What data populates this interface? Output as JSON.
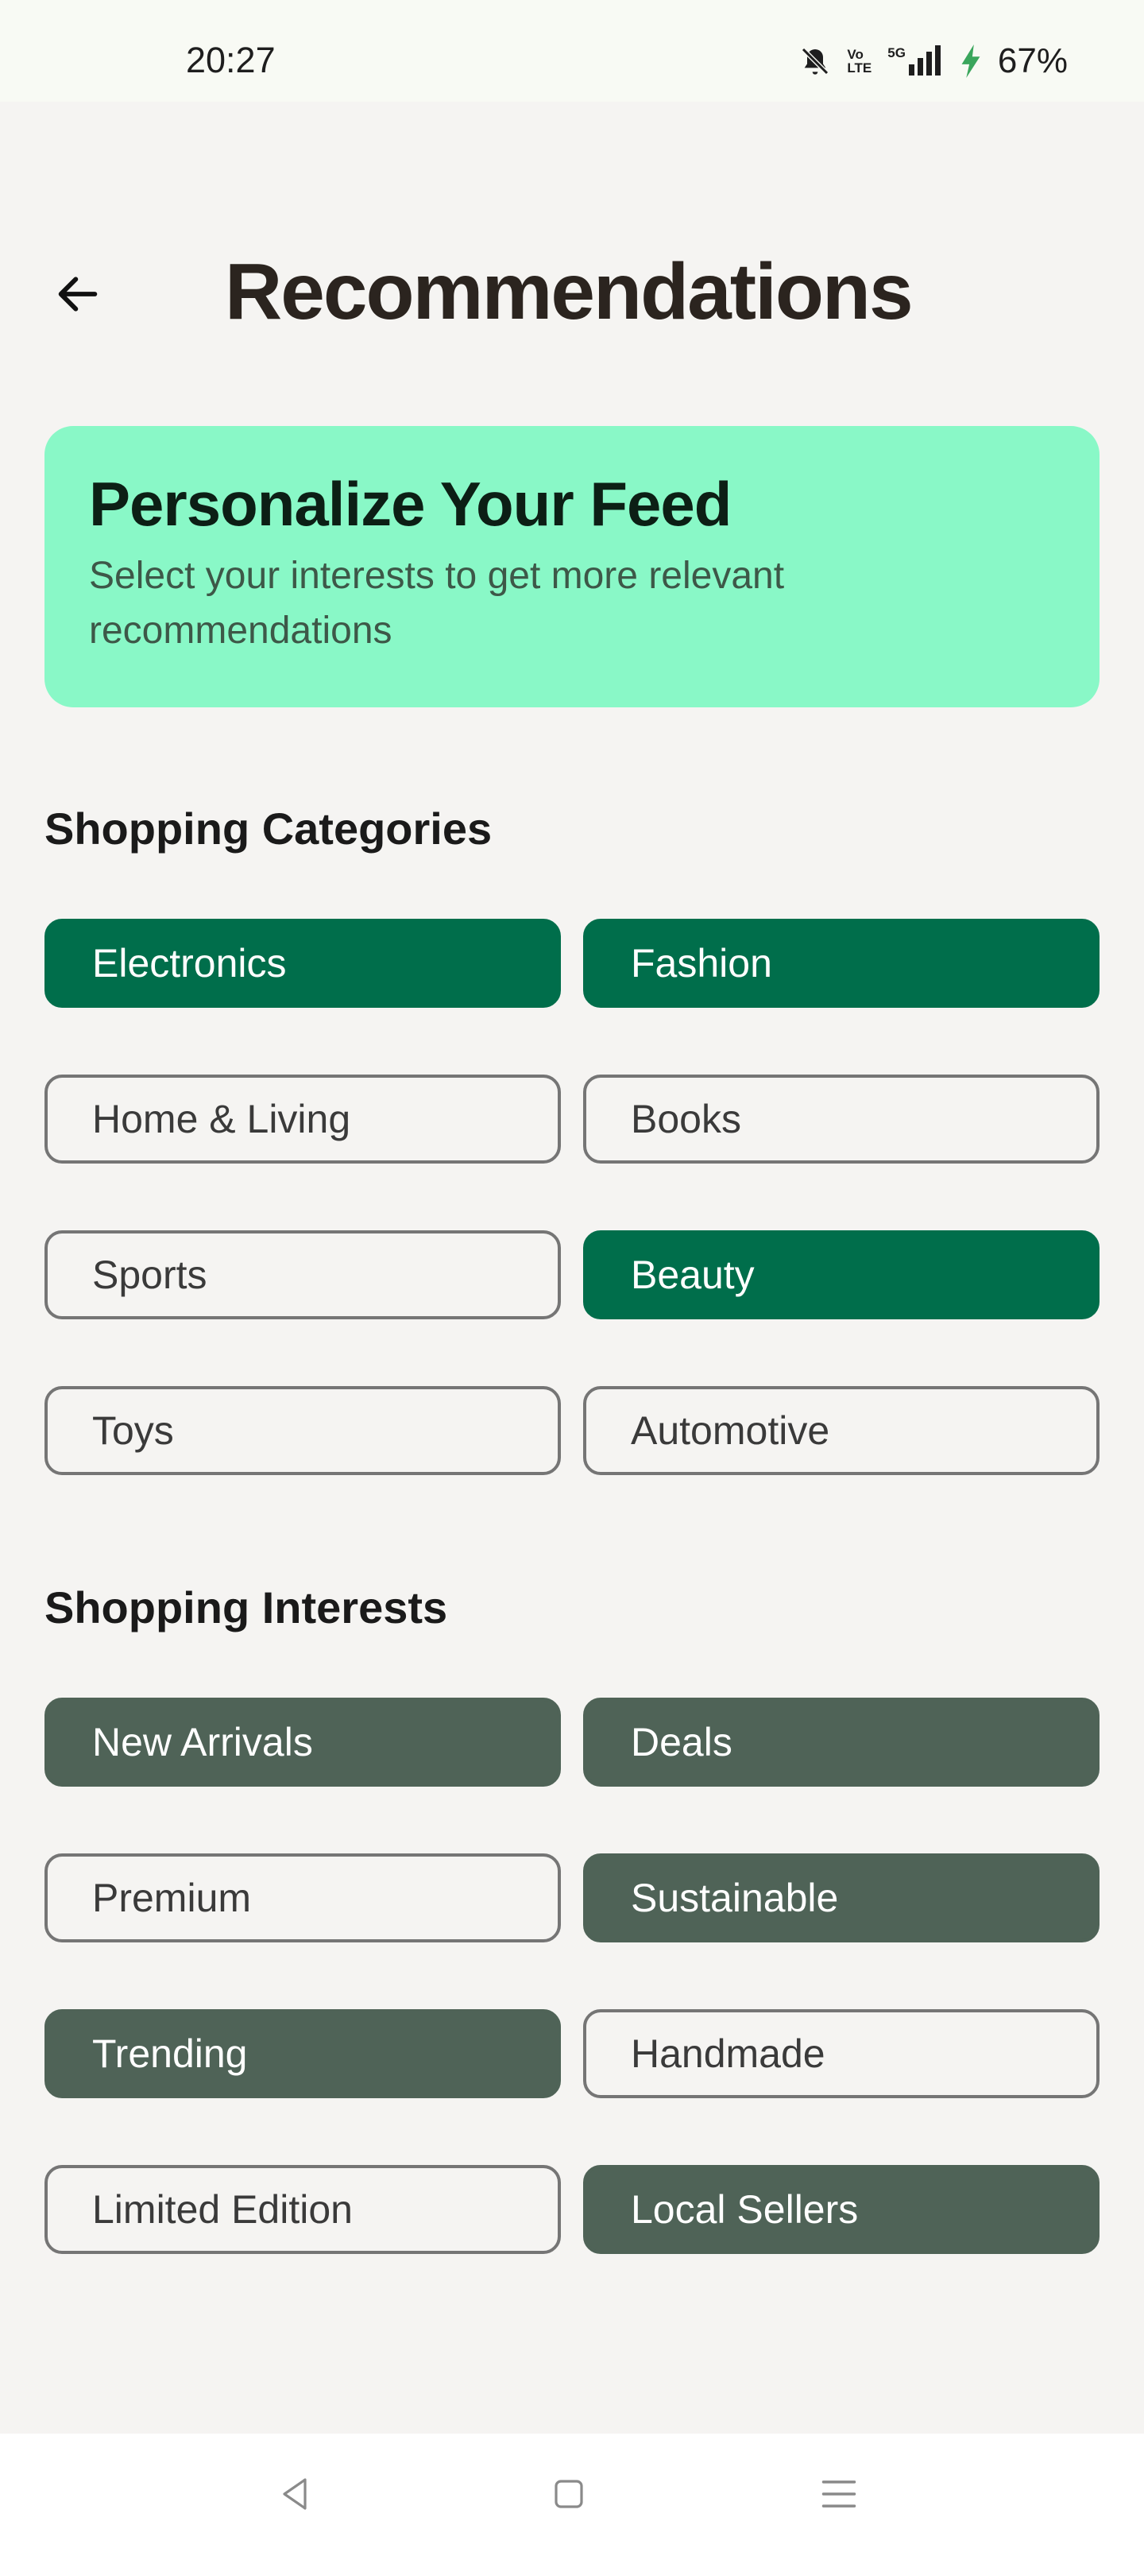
{
  "status_bar": {
    "time": "20:27",
    "battery": "67%",
    "network": "5G",
    "volte_top": "Vo",
    "volte_bottom": "LTE",
    "icons": [
      "bell-muted-icon",
      "volte-icon",
      "signal-icon",
      "charging-icon"
    ]
  },
  "header": {
    "back_icon": "arrow-left-icon",
    "title": "Recommendations"
  },
  "banner": {
    "title": "Personalize Your Feed",
    "subtitle": "Select your interests to get more relevant recommendations",
    "color": "#89f8c7"
  },
  "categories": {
    "title": "Shopping Categories",
    "selected_color": "#006e4b",
    "items": [
      {
        "label": "Electronics",
        "selected": true
      },
      {
        "label": "Fashion",
        "selected": true
      },
      {
        "label": "Home & Living",
        "selected": false
      },
      {
        "label": "Books",
        "selected": false
      },
      {
        "label": "Sports",
        "selected": false
      },
      {
        "label": "Beauty",
        "selected": true
      },
      {
        "label": "Toys",
        "selected": false
      },
      {
        "label": "Automotive",
        "selected": false
      }
    ]
  },
  "interests": {
    "title": "Shopping Interests",
    "selected_color": "#4f6357",
    "items": [
      {
        "label": "New Arrivals",
        "selected": true
      },
      {
        "label": "Deals",
        "selected": true
      },
      {
        "label": "Premium",
        "selected": false
      },
      {
        "label": "Sustainable",
        "selected": true
      },
      {
        "label": "Trending",
        "selected": true
      },
      {
        "label": "Handmade",
        "selected": false
      },
      {
        "label": "Limited Edition",
        "selected": false
      },
      {
        "label": "Local Sellers",
        "selected": true
      }
    ]
  },
  "nav_bar": {
    "icons": [
      "back-triangle-icon",
      "home-square-icon",
      "menu-lines-icon"
    ]
  }
}
